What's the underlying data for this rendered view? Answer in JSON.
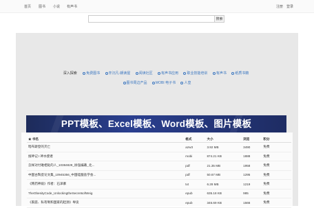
{
  "nav": {
    "left": [
      "首页",
      "图书",
      "小说",
      "有声书"
    ],
    "right": [
      "注册",
      "登录"
    ]
  },
  "search": {
    "placeholder": "",
    "button": "搜索"
  },
  "categories": {
    "label": "深入探索",
    "row1": [
      "免费图书",
      "辛沉凡·朗读屋",
      "阅读社区",
      "有声书应用",
      "职业技能培训",
      "有声书",
      "纸质书籍"
    ],
    "row2": [
      "图书周边产品",
      "MOBI 电子书",
      "人皇"
    ]
  },
  "banner": {
    "text": "PPT模板、Excel模板、Word模板、图片模板"
  },
  "table": {
    "headers": [
      "书名",
      "格式",
      "大小",
      "浏览",
      "积分"
    ],
    "rows": [
      [
        "暗布斯登的灭亡",
        "azw3",
        "3.92 MB",
        "3490",
        "免费"
      ],
      [
        "搜神记 I 神水使者",
        "mobi",
        "874.21 KB",
        "1888",
        "免费"
      ],
      [
        "怎样对付难相处的人_10384829_徐强编著_北...",
        "pdf",
        "21.35 MB",
        "1958",
        "免费"
      ],
      [
        "中国古陶瓷论文集_10945356_中国硅酸盐学会...",
        "pdf",
        "50.67 MB",
        "1295",
        "免费"
      ],
      [
        "《韩药神殿》作者：石泽寨",
        "txt",
        "6.28 MB",
        "1219",
        "免费"
      ],
      [
        "TheObesityCode_UnlockingtheSecretsofWeig",
        "epub",
        "635.18 KB",
        "985",
        "免费"
      ],
      [
        "《家庭、私有制和国家的起源》导读",
        "epub",
        "346.69 KB",
        "1566",
        "免费"
      ]
    ]
  }
}
